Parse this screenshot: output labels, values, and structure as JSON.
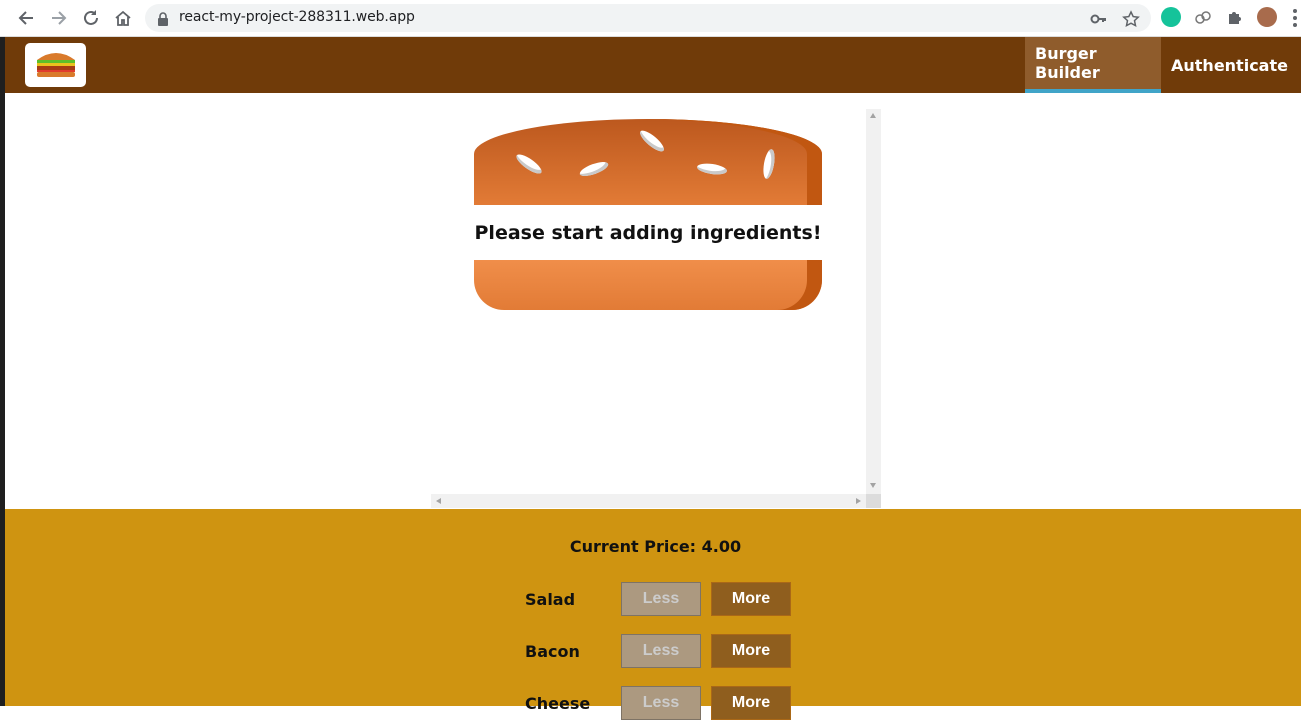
{
  "browser": {
    "url": "react-my-project-288311.web.app"
  },
  "toolbar": {
    "nav": [
      {
        "label": "Burger Builder"
      },
      {
        "label": "Authenticate"
      }
    ]
  },
  "burger": {
    "message": "Please start adding ingredients!"
  },
  "controls": {
    "price_label": "Current Price: 4.00",
    "ingredients": [
      {
        "label": "Salad",
        "less": "Less",
        "more": "More"
      },
      {
        "label": "Bacon",
        "less": "Less",
        "more": "More"
      },
      {
        "label": "Cheese",
        "less": "Less",
        "more": "More"
      }
    ]
  },
  "colors": {
    "toolbar": "#703b09",
    "active_nav": "#8f5c2c",
    "active_border": "#40a4c8",
    "controls_bg": "#cf9411",
    "more_button": "#8f5e1e",
    "less_button_disabled": "#ac9980"
  },
  "icons": [
    "back-icon",
    "forward-icon",
    "reload-icon",
    "home-icon",
    "lock-icon",
    "key-icon",
    "star-icon",
    "grammarly-icon",
    "extension-icon",
    "puzzle-icon",
    "avatar",
    "menu-icon",
    "burger-logo-icon"
  ]
}
